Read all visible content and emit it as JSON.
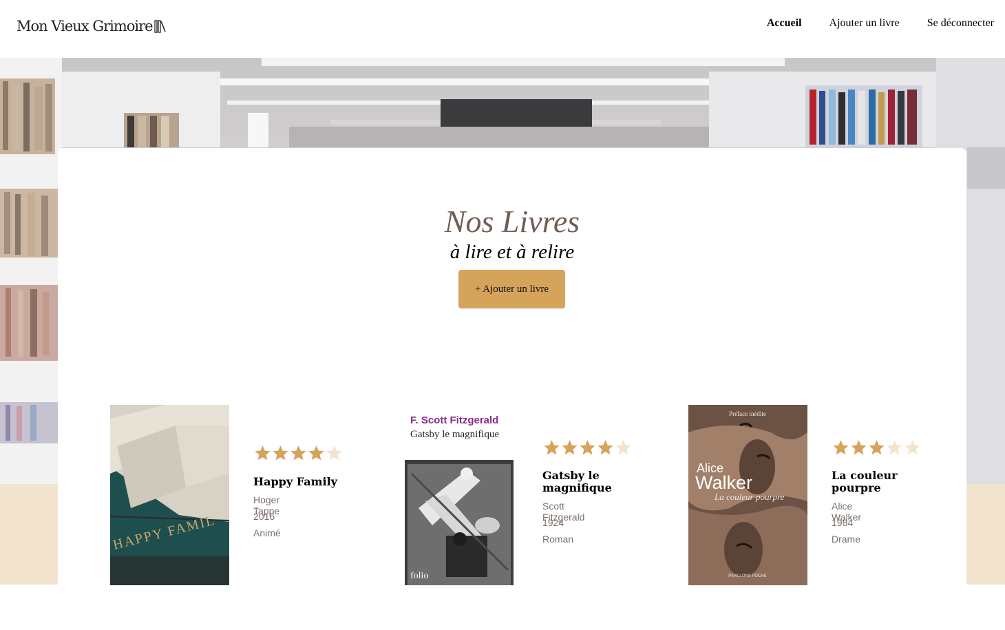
{
  "header": {
    "logo_text": "Mon Vieux Grimoire",
    "nav": [
      {
        "label": "Accueil",
        "active": true
      },
      {
        "label": "Ajouter un livre",
        "active": false
      },
      {
        "label": "Se déconnecter",
        "active": false
      }
    ]
  },
  "hero": {
    "title": "Nos Livres",
    "subtitle": "à lire et à relire",
    "add_button_label": "+ Ajouter un livre"
  },
  "colors": {
    "accent": "#d6a35a",
    "star_filled": "#d6a35a",
    "star_empty": "#f3e4cf",
    "title": "#6f5d55",
    "beige": "#f3e4cf"
  },
  "books": [
    {
      "title": "Happy Family",
      "author": "Hoger Tappe",
      "year": "2016",
      "genre": "Animé",
      "rating": 4,
      "cover_text": "HAPPY FAMIL"
    },
    {
      "title": "Gatsby le magnifique",
      "author": "Scott Fitzgerald",
      "year": "1924",
      "genre": "Roman",
      "rating": 4,
      "cover_author": "F. Scott Fitzgerald",
      "cover_title": "Gatsby le magnifique",
      "cover_publisher": "folio"
    },
    {
      "title": "La couleur pourpre",
      "author": "Alice Walker",
      "year": "1984",
      "genre": "Drame",
      "rating": 3,
      "cover_preface": "Préface inédite",
      "cover_author_first": "Alice",
      "cover_author_last": "Walker",
      "cover_title": "La couleur pourpre",
      "cover_publisher": "PAVILLONS POCHE"
    }
  ]
}
